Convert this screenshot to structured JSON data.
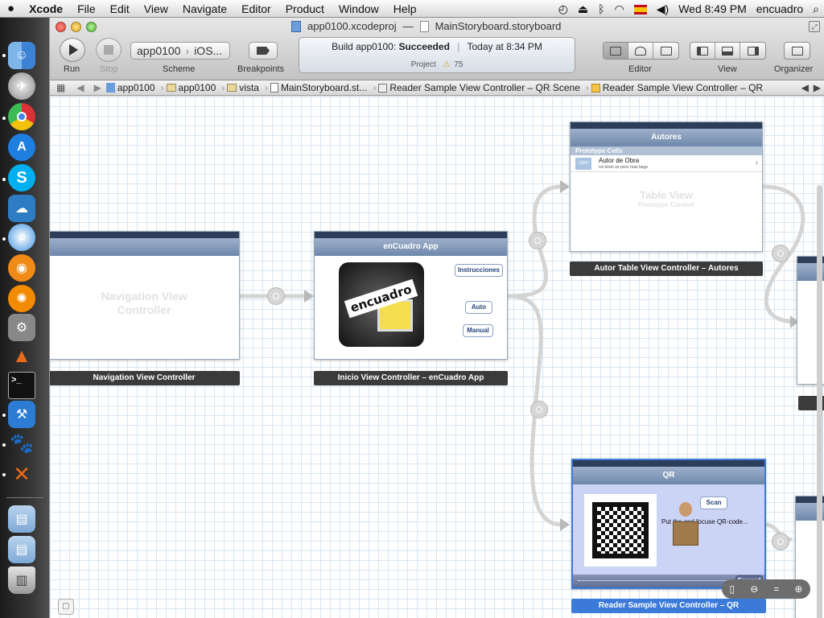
{
  "menubar": {
    "apple": "",
    "app": "Xcode",
    "items": [
      "File",
      "Edit",
      "View",
      "Navigate",
      "Editor",
      "Product",
      "Window",
      "Help"
    ],
    "clock": "Wed 8:49 PM",
    "user": "encuadro"
  },
  "window": {
    "title_project": "app0100.xcodeproj",
    "title_sep": "—",
    "title_file": "MainStoryboard.storyboard"
  },
  "toolbar": {
    "run_label": "Run",
    "stop_label": "Stop",
    "scheme_target": "app0100",
    "scheme_device": "iOS...",
    "scheme_label": "Scheme",
    "breakpoints_label": "Breakpoints",
    "editor_label": "Editor",
    "view_label": "View",
    "organizer_label": "Organizer"
  },
  "status": {
    "build_prefix": "Build app0100:",
    "build_result": "Succeeded",
    "divider": "|",
    "time": "Today at 8:34 PM",
    "project_label": "Project",
    "warnings": "75"
  },
  "jumpbar": {
    "crumbs": [
      "app0100",
      "app0100",
      "vista",
      "MainStoryboard.st...",
      "Reader Sample View Controller – QR Scene",
      "Reader Sample View Controller – QR"
    ]
  },
  "scenes": {
    "nav": {
      "ghost_line1": "Navigation View",
      "ghost_line2": "Controller",
      "label": "Navigation View Controller"
    },
    "inicio": {
      "title": "enCuadro App",
      "logo_text": "encuadro",
      "btn_instrucciones": "Instrucciones",
      "btn_auto": "Auto",
      "btn_manual": "Manual",
      "label": "Inicio View Controller – enCuadro App"
    },
    "autores": {
      "title": "Autores",
      "section": "Prototype Cells",
      "cell_title": "Autor de Obra",
      "cell_subtitle": "Un texto un poco mas largo",
      "thumb": "Utim",
      "ghost_line1": "Table View",
      "ghost_line2": "Prototype Content",
      "label": "Autor Table View Controller – Autores"
    },
    "qr": {
      "title": "QR",
      "scan": "Scan",
      "prompt": "Put the and focuse QR-code...",
      "forward": "Foward",
      "label": "Reader Sample View Controller – QR"
    }
  },
  "colors": {
    "accent": "#2a5ea8",
    "grid": "#d8e6f2",
    "nav_bar": "#7a92b5",
    "dark_label": "#3b3b3b"
  }
}
